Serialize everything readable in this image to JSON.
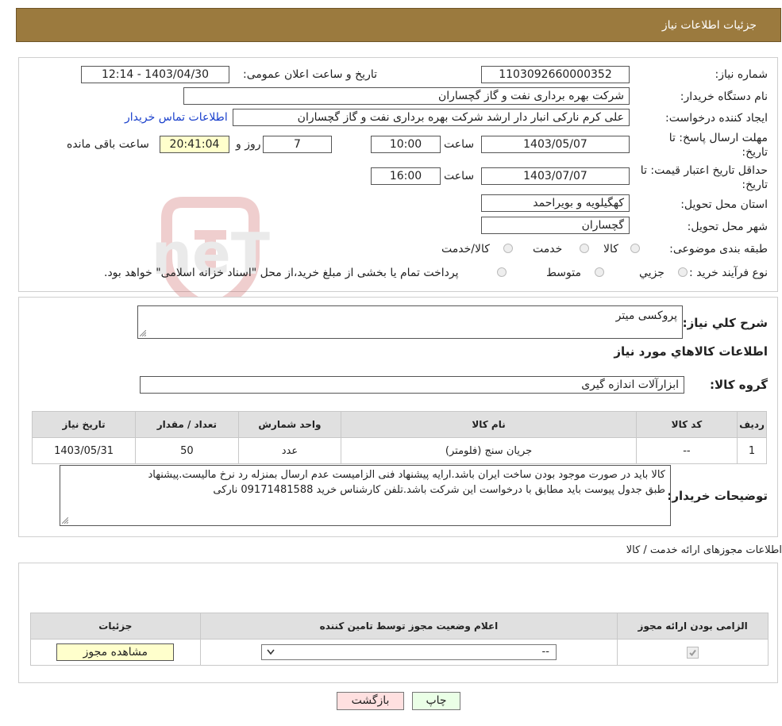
{
  "header": {
    "title": "جزئیات اطلاعات نیاز"
  },
  "need": {
    "number_label": "شماره نیاز:",
    "number_value": "1103092660000352",
    "announce_label": "تاریخ و ساعت اعلان عمومی:",
    "announce_value": "1403/04/30 - 12:14",
    "buyer_label": "نام دستگاه خریدار:",
    "buyer_value": "شرکت بهره برداری نفت و گاز گچساران",
    "creator_label": "ایجاد کننده درخواست:",
    "creator_value": "علی کرم نارکی انبار دار ارشد شرکت بهره برداری نفت و گاز گچساران",
    "contact_link": "اطلاعات تماس خریدار",
    "deadline_label": "مهلت ارسال پاسخ: تا تاریخ:",
    "deadline_date": "1403/05/07",
    "time_label": "ساعت",
    "deadline_time": "10:00",
    "days_value": "7",
    "days_label": "روز و",
    "remaining_value": "20:41:04",
    "remaining_label": "ساعت باقی مانده",
    "validity_label": "حداقل تاریخ اعتبار قیمت: تا تاریخ:",
    "validity_date": "1403/07/07",
    "validity_time": "16:00",
    "province_label": "استان محل تحویل:",
    "province_value": "کهگیلویه و بویراحمد",
    "city_label": "شهر محل تحویل:",
    "city_value": "گچساران",
    "category_label": "طبقه بندی موضوعی:",
    "category_options": [
      "کالا",
      "خدمت",
      "کالا/خدمت"
    ],
    "process_label": "نوع فرآیند خرید :",
    "process_options": [
      "جزیي",
      "متوسط"
    ],
    "process_note": "پرداخت تمام یا بخشی از مبلغ خرید،از محل \"اسناد خزانه اسلامی\" خواهد بود."
  },
  "summary": {
    "label": "شرح کلي نياز:",
    "value": "پروکسی میتر",
    "goods_info_title": "اطلاعات کالاهاي مورد نياز",
    "group_label": "گروه کالا:",
    "group_value": "ابزارآلات اندازه گیری",
    "table": {
      "headers": [
        "رديف",
        "کد کالا",
        "نام کالا",
        "واحد شمارش",
        "تعداد / مقدار",
        "تاريخ نياز"
      ],
      "rows": [
        [
          "1",
          "--",
          "جریان سنج (فلومتر)",
          "عدد",
          "50",
          "1403/05/31"
        ]
      ]
    },
    "buyer_notes_label": "توضیحات خریدار:",
    "buyer_notes_line1": "کالا باید در صورت موجود بودن ساخت ایران باشد.ارایه پیشنهاد فنی الزامیست عدم ارسال بمنزله رد نرخ مالیست.پیشنهاد",
    "buyer_notes_line2": "طبق جدول پیوست باید مطابق با درخواست این شرکت باشد.تلفن کارشناس خرید 09171481588 نارکی"
  },
  "permits": {
    "section_title": "اطلاعات مجوزهای ارائه خدمت / کالا",
    "headers": [
      "الزامی بودن ارائه مجوز",
      "اعلام وضعیت مجوز توسط تامین کننده",
      "جزئیات"
    ],
    "select_value": "--",
    "view_button": "مشاهده مجوز"
  },
  "footer": {
    "print_button": "چاپ",
    "back_button": "بازگشت"
  },
  "watermark": {
    "text": "AriaTender.neT"
  },
  "colors": {
    "header_bg": "#9b7a3e",
    "link": "#1a40cc",
    "yellow_field": "#ffffcc",
    "back_button_bg": "#ffe0e0",
    "print_button_bg": "#eaffe6"
  }
}
